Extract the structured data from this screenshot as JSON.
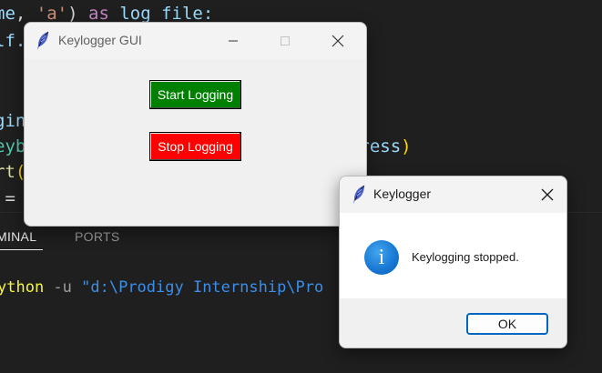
{
  "editor": {
    "lines": [
      [
        {
          "t": "me",
          "c": "c-var"
        },
        {
          "t": ", ",
          "c": "c-op"
        },
        {
          "t": "'a'",
          "c": "c-str"
        },
        {
          "t": ") ",
          "c": "c-op"
        },
        {
          "t": "as",
          "c": "c-kw"
        },
        {
          "t": " log_file:",
          "c": "c-var"
        }
      ],
      [
        {
          "t": "lf.",
          "c": "c-var"
        }
      ],
      [],
      [],
      [
        {
          "t": "ging",
          "c": "c-var"
        }
      ],
      [
        {
          "t": "eyb",
          "c": "c-cls"
        },
        {
          "t": "                                ress",
          "c": "c-var"
        },
        {
          "t": ")",
          "c": "c-br"
        }
      ],
      [
        {
          "t": "rt",
          "c": "c-fn"
        },
        {
          "t": "(",
          "c": "c-br"
        }
      ],
      [
        {
          "t": " = ",
          "c": "c-op"
        }
      ]
    ],
    "panel_tabs": [
      {
        "label": "MINAL",
        "active": true
      },
      {
        "label": "PORTS",
        "active": false
      }
    ],
    "terminal": {
      "cmd": "ython",
      "flag": " -u ",
      "path": "\"d:\\Prodigy Internship\\Pro"
    }
  },
  "gui_window": {
    "title": "Keylogger GUI",
    "start_label": "Start Logging",
    "stop_label": "Stop Logging",
    "colors": {
      "start": "#008000",
      "stop": "#ff0000"
    }
  },
  "message_box": {
    "title": "Keylogger",
    "message": "Keylogging stopped.",
    "icon": "info-icon",
    "ok_label": "OK"
  }
}
